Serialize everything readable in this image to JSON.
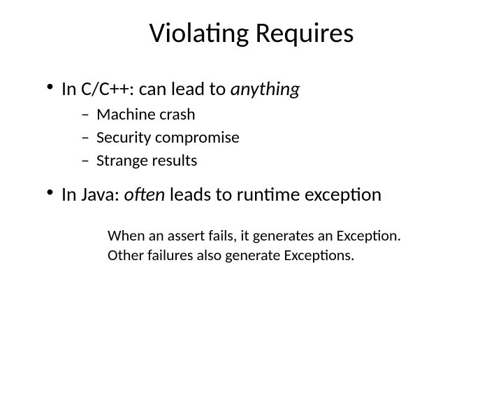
{
  "title": "Violating Requires",
  "bullets": {
    "b1": {
      "text_a": "In C/C++: can lead to ",
      "text_b": "anything",
      "sub": [
        "Machine crash",
        "Security compromise",
        "Strange results"
      ]
    },
    "b2": {
      "text_a": "In Java: ",
      "text_b": "often",
      "text_c": " leads to runtime exception"
    }
  },
  "note_line1": "When an assert fails, it generates an Exception.",
  "note_line2": "Other failures also generate Exceptions."
}
